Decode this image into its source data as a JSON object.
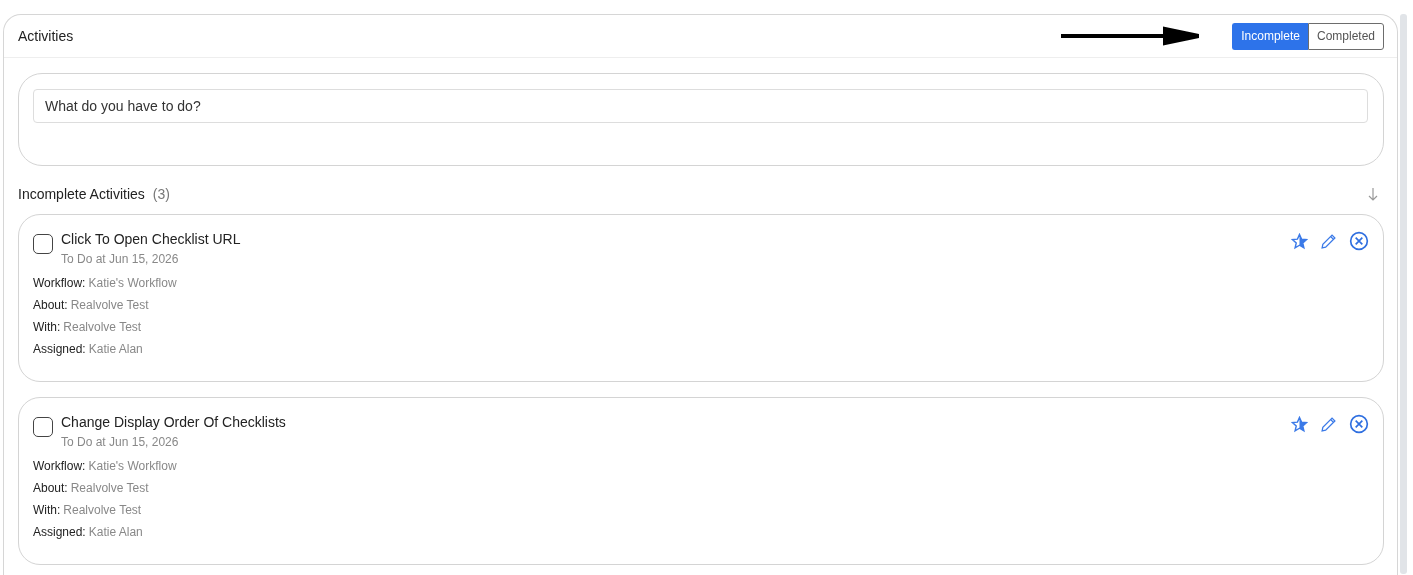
{
  "panel": {
    "title": "Activities"
  },
  "filter_toggle": [
    {
      "label": "Incomplete",
      "selected": true
    },
    {
      "label": "Completed",
      "selected": false
    }
  ],
  "composer": {
    "placeholder": "What do you have to do?"
  },
  "section": {
    "title": "Incomplete Activities",
    "count": "(3)"
  },
  "activities": [
    {
      "title": "Click To Open Checklist URL",
      "checked": false,
      "due": "To Do at Jun 15, 2026",
      "fields": [
        {
          "label": "Workflow:",
          "value": "Katie's Workflow"
        },
        {
          "label": "About:",
          "value": "Realvolve Test"
        },
        {
          "label": "With:",
          "value": "Realvolve Test"
        },
        {
          "label": "Assigned:",
          "value": "Katie Alan"
        }
      ]
    },
    {
      "title": "Change Display Order Of Checklists",
      "checked": false,
      "due": "To Do at Jun 15, 2026",
      "fields": [
        {
          "label": "Workflow:",
          "value": "Katie's Workflow"
        },
        {
          "label": "About:",
          "value": "Realvolve Test"
        },
        {
          "label": "With:",
          "value": "Realvolve Test"
        },
        {
          "label": "Assigned:",
          "value": "Katie Alan"
        }
      ]
    }
  ]
}
